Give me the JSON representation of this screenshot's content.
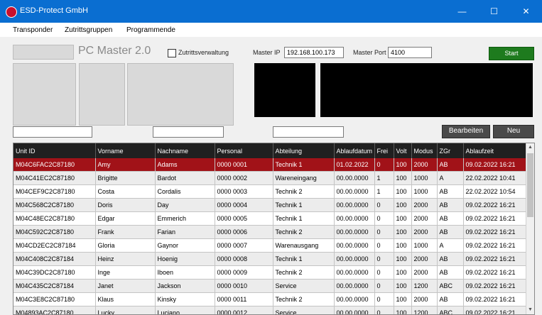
{
  "window": {
    "title": "ESD-Protect GmbH",
    "controls": {
      "minimize": "—",
      "maximize": "☐",
      "close": "✕"
    }
  },
  "menu": [
    "Transponder",
    "Zutrittsgruppen",
    "Programmende"
  ],
  "brand": "PC Master 2.0",
  "access_checkbox_label": "Zutrittsverwaltung",
  "master_ip": {
    "label": "Master IP",
    "value": "192.168.100.173"
  },
  "master_port": {
    "label": "Master Port",
    "value": "4100"
  },
  "buttons": {
    "start": "Start",
    "edit": "Bearbeiten",
    "new": "Neu"
  },
  "filters": [
    "",
    "",
    ""
  ],
  "table": {
    "columns": [
      "Unit ID",
      "Vorname",
      "Nachname",
      "Personal",
      "Abteilung",
      "Ablaufdatum",
      "Frei",
      "Volt",
      "Modus",
      "ZGr",
      "Ablaufzeit"
    ],
    "rows": [
      [
        "M04C6FAC2C87180",
        "Amy",
        "Adams",
        "0000 0001",
        "Technik 1",
        "01.02.2022",
        "0",
        "100",
        "2000",
        "AB",
        "09.02.2022 16:21"
      ],
      [
        "M04C41EC2C87180",
        "Brigitte",
        "Bardot",
        "0000 0002",
        "Wareneingang",
        "00.00.0000",
        "1",
        "100",
        "1000",
        "A",
        "22.02.2022 10:41"
      ],
      [
        "M04CEF9C2C87180",
        "Costa",
        "Cordalis",
        "0000 0003",
        "Technik 2",
        "00.00.0000",
        "1",
        "100",
        "1000",
        "AB",
        "22.02.2022 10:54"
      ],
      [
        "M04C568C2C87180",
        "Doris",
        "Day",
        "0000 0004",
        "Technik 1",
        "00.00.0000",
        "0",
        "100",
        "2000",
        "AB",
        "09.02.2022 16:21"
      ],
      [
        "M04C48EC2C87180",
        "Edgar",
        "Emmerich",
        "0000 0005",
        "Technik 1",
        "00.00.0000",
        "0",
        "100",
        "2000",
        "AB",
        "09.02.2022 16:21"
      ],
      [
        "M04C592C2C87180",
        "Frank",
        "Farian",
        "0000 0006",
        "Technik 2",
        "00.00.0000",
        "0",
        "100",
        "2000",
        "AB",
        "09.02.2022 16:21"
      ],
      [
        "M04CD2EC2C87184",
        "Gloria",
        "Gaynor",
        "0000 0007",
        "Warenausgang",
        "00.00.0000",
        "0",
        "100",
        "1000",
        "A",
        "09.02.2022 16:21"
      ],
      [
        "M04C408C2C87184",
        "Heinz",
        "Hoenig",
        "0000 0008",
        "Technik 1",
        "00.00.0000",
        "0",
        "100",
        "2000",
        "AB",
        "09.02.2022 16:21"
      ],
      [
        "M04C39DC2C87180",
        "Inge",
        "Iboen",
        "0000 0009",
        "Technik 2",
        "00.00.0000",
        "0",
        "100",
        "2000",
        "AB",
        "09.02.2022 16:21"
      ],
      [
        "M04C435C2C87184",
        "Janet",
        "Jackson",
        "0000 0010",
        "Service",
        "00.00.0000",
        "0",
        "100",
        "1200",
        "ABC",
        "09.02.2022 16:21"
      ],
      [
        "M04C3E8C2C87180",
        "Klaus",
        "Kinsky",
        "0000 0011",
        "Technik 2",
        "00.00.0000",
        "0",
        "100",
        "2000",
        "AB",
        "09.02.2022 16:21"
      ],
      [
        "M04893AC2C87180",
        "Lucky",
        "Luciano",
        "0000 0012",
        "Service",
        "00.00.0000",
        "0",
        "100",
        "1200",
        "ABC",
        "09.02.2022 16:21"
      ]
    ]
  },
  "colors": {
    "titlebar": "#0a6ed1",
    "selected_row": "#a11218",
    "start_button": "#1e7b1e",
    "header": "#202020"
  },
  "icons": {
    "app": "esd-logo-icon",
    "scroll_up": "▲",
    "scroll_down": "▼"
  }
}
